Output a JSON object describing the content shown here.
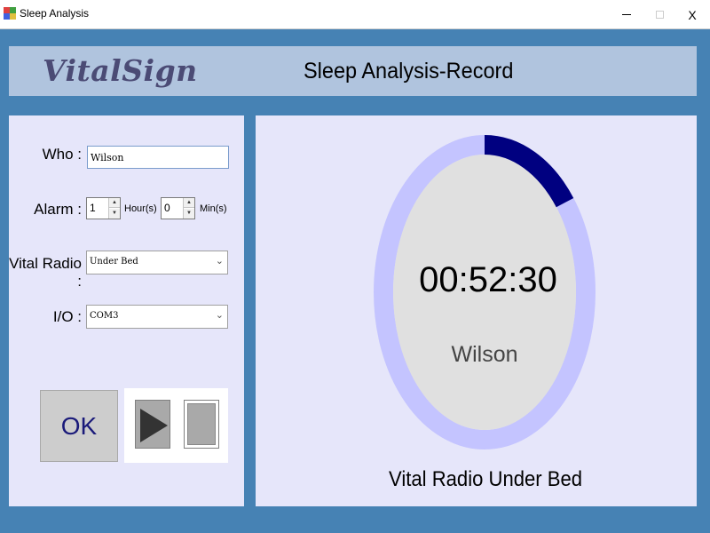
{
  "window": {
    "title": "Sleep Analysis",
    "min_label": "",
    "close_label": "X"
  },
  "header": {
    "logo_text": "VitalSign",
    "title": "Sleep Analysis-Record"
  },
  "form": {
    "who_label": "Who :",
    "who_value": "Wilson",
    "alarm_label": "Alarm :",
    "alarm_hours": "1",
    "hour_unit": "Hour(s)",
    "alarm_minutes": "0",
    "min_unit": "Min(s)",
    "vital_radio_label": "Vital Radio :",
    "vital_radio_value": "Under Bed",
    "io_label": "I/O :",
    "io_value": "COM3",
    "ok_label": "OK"
  },
  "monitor": {
    "elapsed_time": "00:52:30",
    "name": "Wilson",
    "status": "Vital Radio Under Bed",
    "progress_fraction": 0.146,
    "colors": {
      "ring_track": "#c4c4ff",
      "ring_progress": "#000080",
      "ring_inner": "#e0e0e0"
    }
  },
  "icons": {
    "app": "app-icon",
    "play": "play-icon",
    "stop": "stop-icon"
  }
}
